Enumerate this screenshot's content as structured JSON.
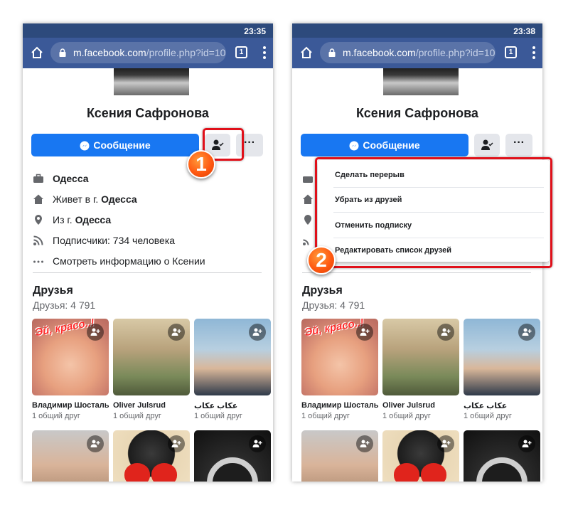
{
  "colors": {
    "chrome_bar": "#3b5998",
    "status_bar": "#2d4a7c",
    "primary_button": "#1877f2",
    "secondary_button": "#e4e6eb",
    "highlight": "#e0101a",
    "badge": "#ff5a12"
  },
  "browser": {
    "url_host": "m.facebook.com",
    "url_path": "/profile.php?id=10(",
    "tab_count": "1",
    "icons": [
      "home-icon",
      "lock-icon",
      "tabs-icon",
      "overflow-menu-icon"
    ]
  },
  "left": {
    "status_time": "23:35",
    "badge_number": "1"
  },
  "right": {
    "status_time": "23:38",
    "badge_number": "2",
    "dropdown": {
      "items": [
        {
          "label": "Сделать перерыв"
        },
        {
          "label": "Убрать из друзей"
        },
        {
          "label": "Отменить подписку"
        },
        {
          "label": "Редактировать список друзей"
        }
      ]
    }
  },
  "profile": {
    "name": "Ксения Сафронова",
    "message_button": "Сообщение",
    "more_button": "···",
    "info": [
      {
        "icon": "briefcase-icon",
        "prefix": "",
        "bold": "Одесса"
      },
      {
        "icon": "house-icon",
        "prefix": "Живет в г. ",
        "bold": "Одесса"
      },
      {
        "icon": "location-pin-icon",
        "prefix": "Из г. ",
        "bold": "Одесса"
      },
      {
        "icon": "rss-icon",
        "prefix": "Подписчики: 734 человека",
        "bold": ""
      },
      {
        "icon": "more-dots-icon",
        "prefix": "Смотреть информацию о Ксении",
        "bold": ""
      }
    ]
  },
  "friends": {
    "title": "Друзья",
    "count": "Друзья: 4 791",
    "tile_sticker": "Эй, красо..!",
    "list": [
      {
        "name": "Владимир Шосталь",
        "mutual": "1 общий друг"
      },
      {
        "name": "Oliver Julsrud",
        "mutual": "1 общий друг"
      },
      {
        "name": "عكاب عكاب",
        "mutual": "1 общий друг"
      }
    ]
  }
}
